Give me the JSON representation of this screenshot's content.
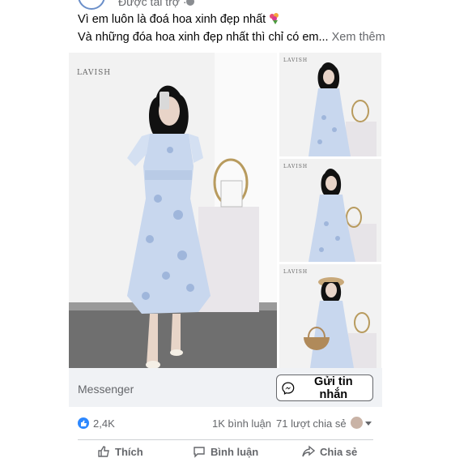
{
  "header": {
    "sponsored_label": "Được tài trợ ·"
  },
  "caption": {
    "line1": "Vì em luôn là đoá hoa xinh đẹp nhất",
    "line2": "Và những đóa hoa xinh đẹp nhất thì chỉ có em...",
    "see_more": "Xem thêm"
  },
  "photos": {
    "brand": "LAVISH"
  },
  "cta": {
    "source_label": "Messenger",
    "button_label": "Gửi tin nhắn"
  },
  "stats": {
    "reactions": "2,4K",
    "comments": "1K bình luận",
    "shares": "71 lượt chia sẻ"
  },
  "actions": {
    "like": "Thích",
    "comment": "Bình luận",
    "share": "Chia sẻ"
  },
  "colors": {
    "accent": "#1877f2",
    "muted_text": "#65676b",
    "dress_blue": "#b8cbe6"
  }
}
